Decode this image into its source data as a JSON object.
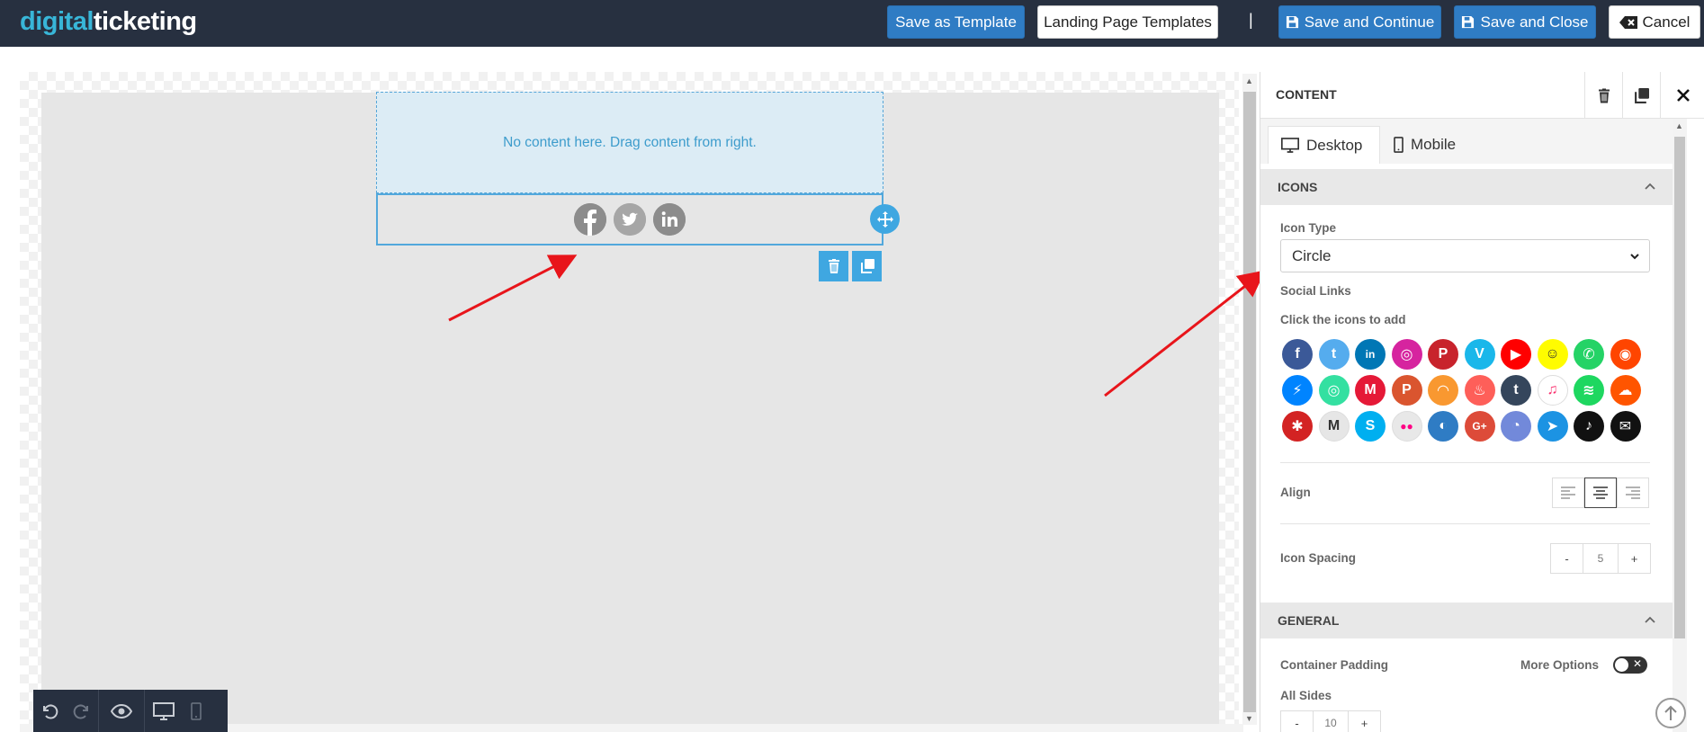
{
  "header": {
    "logo_part1": "digital",
    "logo_part2": "ticketing",
    "save_template": "Save as Template",
    "landing_templates": "Landing Page Templates",
    "separator": "|",
    "save_continue": "Save and Continue",
    "save_close": "Save and Close",
    "cancel": "Cancel"
  },
  "canvas": {
    "dropzone_text": "No content here. Drag content from right.",
    "social_icons": [
      {
        "icon": "facebook-icon",
        "glyph": "f",
        "color": "#8c8c8c"
      },
      {
        "icon": "twitter-icon",
        "glyph": "t",
        "color": "#a6a6a6"
      },
      {
        "icon": "linkedin-icon",
        "glyph": "in",
        "color": "#8c8c8c"
      }
    ]
  },
  "panel": {
    "title": "CONTENT",
    "tab_desktop": "Desktop",
    "tab_mobile": "Mobile",
    "icons_section": "ICONS",
    "icon_type_label": "Icon Type",
    "icon_type_value": "Circle",
    "social_links_label": "Social Links",
    "click_icons_label": "Click the icons to add",
    "align_label": "Align",
    "icon_spacing_label": "Icon Spacing",
    "icon_spacing_value": "5",
    "minus": "-",
    "plus": "+",
    "general_section": "GENERAL",
    "container_padding_label": "Container Padding",
    "more_options_label": "More Options",
    "all_sides_label": "All Sides",
    "all_sides_value": "10"
  },
  "social_grid": [
    {
      "name": "facebook-icon",
      "glyph": "f",
      "color": "#3b5998"
    },
    {
      "name": "twitter-icon",
      "glyph": "t",
      "color": "#55acee"
    },
    {
      "name": "linkedin-icon",
      "glyph": "in",
      "color": "#0077b5"
    },
    {
      "name": "instagram-icon",
      "glyph": "◎",
      "color": "#d6249f"
    },
    {
      "name": "pinterest-icon",
      "glyph": "P",
      "color": "#c8232c"
    },
    {
      "name": "vimeo-icon",
      "glyph": "V",
      "color": "#1ab7ea"
    },
    {
      "name": "youtube-icon",
      "glyph": "▶",
      "color": "#ff0000"
    },
    {
      "name": "snapchat-icon",
      "glyph": "☺",
      "color": "#fffc00"
    },
    {
      "name": "whatsapp-icon",
      "glyph": "✆",
      "color": "#25d366"
    },
    {
      "name": "reddit-icon",
      "glyph": "◉",
      "color": "#ff4500"
    },
    {
      "name": "messenger-icon",
      "glyph": "⚡",
      "color": "#0084ff"
    },
    {
      "name": "tripadvisor-icon",
      "glyph": "◎",
      "color": "#34e0a1"
    },
    {
      "name": "meetup-icon",
      "glyph": "M",
      "color": "#e51937"
    },
    {
      "name": "producthunt-icon",
      "glyph": "P",
      "color": "#da552f"
    },
    {
      "name": "rss-icon",
      "glyph": "◠",
      "color": "#f99830"
    },
    {
      "name": "tinder-icon",
      "glyph": "♨",
      "color": "#fe5f59"
    },
    {
      "name": "tumblr-icon",
      "glyph": "t",
      "color": "#35465c"
    },
    {
      "name": "applemusic-icon",
      "glyph": "♫",
      "color": "#ffffff"
    },
    {
      "name": "spotify-icon",
      "glyph": "≋",
      "color": "#1ed760"
    },
    {
      "name": "soundcloud-icon",
      "glyph": "☁",
      "color": "#ff5500"
    },
    {
      "name": "yelp-icon",
      "glyph": "✱",
      "color": "#d32323"
    },
    {
      "name": "medium-icon",
      "glyph": "M",
      "color": "#e6e6e6"
    },
    {
      "name": "skype-icon",
      "glyph": "S",
      "color": "#00aff0"
    },
    {
      "name": "flickr-icon",
      "glyph": "●●",
      "color": "#e8e8e8"
    },
    {
      "name": "github-icon",
      "glyph": "◐",
      "color": "#2f7cc4"
    },
    {
      "name": "googleplus-icon",
      "glyph": "G+",
      "color": "#dd4b39"
    },
    {
      "name": "discord-icon",
      "glyph": "◔",
      "color": "#7289da"
    },
    {
      "name": "telegram-icon",
      "glyph": "➤",
      "color": "#1c93e3"
    },
    {
      "name": "tiktok-icon",
      "glyph": "♪",
      "color": "#111111"
    },
    {
      "name": "email-icon",
      "glyph": "✉",
      "color": "#111111"
    }
  ],
  "colors": {
    "topbar": "#273040",
    "primary_button": "#2f7cc4",
    "accent": "#3fa7e1",
    "annotation_arrow": "#e8151b"
  }
}
